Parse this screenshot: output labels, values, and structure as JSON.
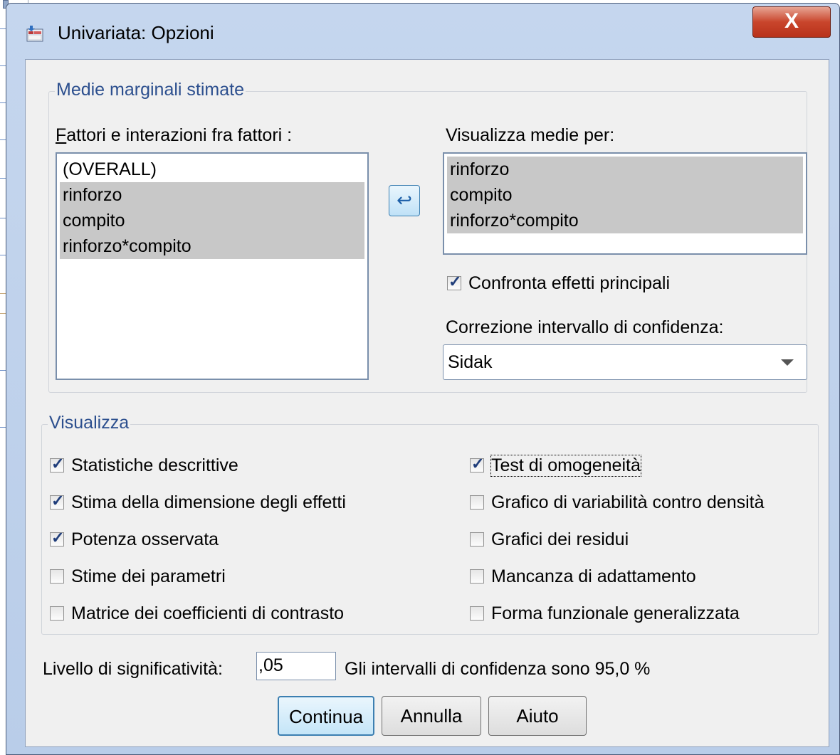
{
  "window": {
    "title": "Univariata: Opzioni",
    "close_label": "X"
  },
  "emm": {
    "group_title": "Medie marginali stimate",
    "factors_label": "Fattori e interazioni fra fattori :",
    "factors": [
      {
        "label": "(OVERALL)",
        "selected": false
      },
      {
        "label": "rinforzo",
        "selected": true
      },
      {
        "label": "compito",
        "selected": true
      },
      {
        "label": "rinforzo*compito",
        "selected": true
      }
    ],
    "display_label": "Visualizza medie per:",
    "display_items": [
      "rinforzo",
      "compito",
      "rinforzo*compito"
    ],
    "compare_label": "Confronta effetti principali",
    "compare_checked": true,
    "correction_label": "Correzione intervallo di confidenza:",
    "correction_value": "Sidak"
  },
  "display": {
    "group_title": "Visualizza",
    "left": [
      {
        "label": "Statistiche descrittive",
        "checked": true
      },
      {
        "label": "Stima della dimensione degli effetti",
        "checked": true
      },
      {
        "label": "Potenza osservata",
        "checked": true
      },
      {
        "label": "Stime dei parametri",
        "checked": false
      },
      {
        "label": "Matrice dei coefficienti di contrasto",
        "checked": false
      }
    ],
    "right": [
      {
        "label": "Test di omogeneità",
        "checked": true
      },
      {
        "label": "Grafico di variabilità contro densità",
        "checked": false
      },
      {
        "label": "Grafici dei residui",
        "checked": false
      },
      {
        "label": "Mancanza di adattamento",
        "checked": false
      },
      {
        "label": "Forma funzionale generalizzata",
        "checked": false
      }
    ]
  },
  "significance": {
    "label": "Livello di significatività:",
    "value": ",05",
    "confidence_text": "Gli intervalli di confidenza sono 95,0 %"
  },
  "buttons": {
    "continue": "Continua",
    "cancel": "Annulla",
    "help": "Aiuto"
  }
}
